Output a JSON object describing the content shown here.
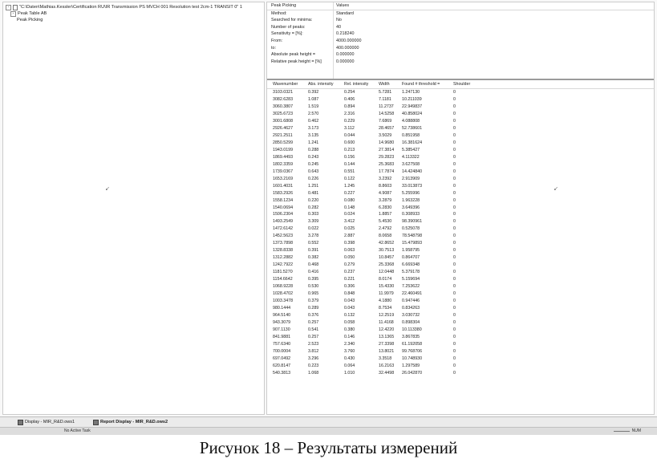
{
  "tree": {
    "file": "\"C:\\Daten\\Mathias.Kessler\\Certification RU\\IR Transmission PS MVCH 001 Resolution test 2cm-1 TRANSIT 0\" 1",
    "table": "Peak Table AB",
    "method": "Peak Picking"
  },
  "params": {
    "header": [
      "Peak Picking",
      "Values"
    ],
    "rows": [
      [
        "Method:",
        "Standard"
      ],
      [
        "Searched for minima:",
        "No"
      ],
      [
        "Number of peaks:",
        "40"
      ],
      [
        "Sensitivity = [%]:",
        "0.218240"
      ],
      [
        "From:",
        "4000.000000"
      ],
      [
        "   to:",
        "400.000000"
      ],
      [
        "Absolute peak height =",
        "0.000000"
      ],
      [
        "Relative peak height = [%]",
        "0.000000"
      ]
    ]
  },
  "results": {
    "columns": [
      "Wavenumber",
      "Abs. intensity",
      "Rel. intensity",
      "Width",
      "Found # threshold =",
      "Shoulder"
    ],
    "rows": [
      [
        "3103.0321",
        "0.392",
        "0.254",
        "5.7281",
        "1.247130",
        "0"
      ],
      [
        "3082.6283",
        "1.087",
        "0.406",
        "7.1181",
        "10.211039",
        "0"
      ],
      [
        "3060.3807",
        "1.519",
        "0.894",
        "11.2737",
        "22.949837",
        "0"
      ],
      [
        "3025.6723",
        "2.570",
        "2.316",
        "14.5258",
        "40.858024",
        "0"
      ],
      [
        "3001.6808",
        "0.462",
        "0.229",
        "7.6869",
        "4.088808",
        "0"
      ],
      [
        "2926.4627",
        "3.173",
        "3.112",
        "28.4657",
        "52.738601",
        "0"
      ],
      [
        "2921.2511",
        "3.135",
        "0.044",
        "3.5029",
        "0.851958",
        "0"
      ],
      [
        "2850.5299",
        "1.241",
        "0.600",
        "14.9680",
        "16.381624",
        "0"
      ],
      [
        "1943.0199",
        "0.288",
        "0.213",
        "27.3814",
        "5.385427",
        "0"
      ],
      [
        "1869.4493",
        "0.243",
        "0.156",
        "29.2823",
        "4.113322",
        "0"
      ],
      [
        "1802.3359",
        "0.245",
        "0.144",
        "25.3683",
        "3.627508",
        "0"
      ],
      [
        "1739.0367",
        "0.643",
        "0.551",
        "17.7874",
        "14.424840",
        "0"
      ],
      [
        "1653.2169",
        "0.226",
        "0.122",
        "3.2392",
        "2.913909",
        "0"
      ],
      [
        "1601.4031",
        "1.251",
        "1.245",
        "8.8603",
        "33.013873",
        "0"
      ],
      [
        "1583.2926",
        "0.481",
        "0.227",
        "4.9087",
        "5.255996",
        "0"
      ],
      [
        "1558.1234",
        "0.220",
        "0.080",
        "3.2879",
        "1.963228",
        "0"
      ],
      [
        "1540.0694",
        "0.282",
        "0.148",
        "6.2830",
        "3.649396",
        "0"
      ],
      [
        "1506.2304",
        "0.303",
        "0.024",
        "1.8857",
        "0.308933",
        "0"
      ],
      [
        "1493.2549",
        "3.309",
        "3.412",
        "5.4530",
        "98.390961",
        "0"
      ],
      [
        "1472.6142",
        "0.022",
        "0.025",
        "2.4792",
        "0.525078",
        "0"
      ],
      [
        "1452.5623",
        "3.278",
        "2.887",
        "8.0658",
        "78.548798",
        "0"
      ],
      [
        "1373.7898",
        "0.552",
        "0.398",
        "42.8652",
        "15.479893",
        "0"
      ],
      [
        "1328.8338",
        "0.391",
        "0.063",
        "30.7513",
        "1.958795",
        "0"
      ],
      [
        "1312.2882",
        "0.382",
        "0.050",
        "10.8457",
        "0.864707",
        "0"
      ],
      [
        "1242.7922",
        "0.468",
        "0.279",
        "25.3368",
        "6.669348",
        "0"
      ],
      [
        "1181.5270",
        "0.416",
        "0.237",
        "12.0448",
        "5.379178",
        "0"
      ],
      [
        "1154.6642",
        "0.395",
        "0.221",
        "8.0174",
        "5.159694",
        "0"
      ],
      [
        "1068.9228",
        "0.530",
        "0.306",
        "15.4330",
        "7.253622",
        "0"
      ],
      [
        "1028.4702",
        "0.965",
        "0.848",
        "11.9979",
        "22.460491",
        "0"
      ],
      [
        "1003.3478",
        "0.379",
        "0.043",
        "4.1880",
        "0.947446",
        "0"
      ],
      [
        "980.1444",
        "0.289",
        "0.043",
        "8.7534",
        "0.834263",
        "0"
      ],
      [
        "964.5140",
        "0.376",
        "0.132",
        "12.2519",
        "3.030732",
        "0"
      ],
      [
        "943.3079",
        "0.257",
        "0.058",
        "11.4168",
        "0.898304",
        "0"
      ],
      [
        "907.1130",
        "0.541",
        "0.380",
        "12.4220",
        "10.113380",
        "0"
      ],
      [
        "841.9881",
        "0.257",
        "0.146",
        "13.1365",
        "3.867835",
        "0"
      ],
      [
        "757.6340",
        "2.523",
        "2.340",
        "27.3398",
        "61.192058",
        "0"
      ],
      [
        "700.0004",
        "3.812",
        "3.760",
        "13.8021",
        "99.768706",
        "0"
      ],
      [
        "697.0492",
        "3.296",
        "0.430",
        "3.3518",
        "10.748930",
        "0"
      ],
      [
        "620.8147",
        "0.223",
        "0.064",
        "16.2163",
        "1.297589",
        "0"
      ],
      [
        "540.3813",
        "1.068",
        "1.010",
        "32.4498",
        "26.042870",
        "0"
      ]
    ]
  },
  "taskbar": {
    "tab1": "Display - MIR_R&D.ows1",
    "tab2": "Report Display - MIR_R&D.ows2"
  },
  "status": {
    "text": "No Active Task",
    "zoom": "NUM"
  },
  "caption": "Рисунок 18 – Результаты измерений"
}
